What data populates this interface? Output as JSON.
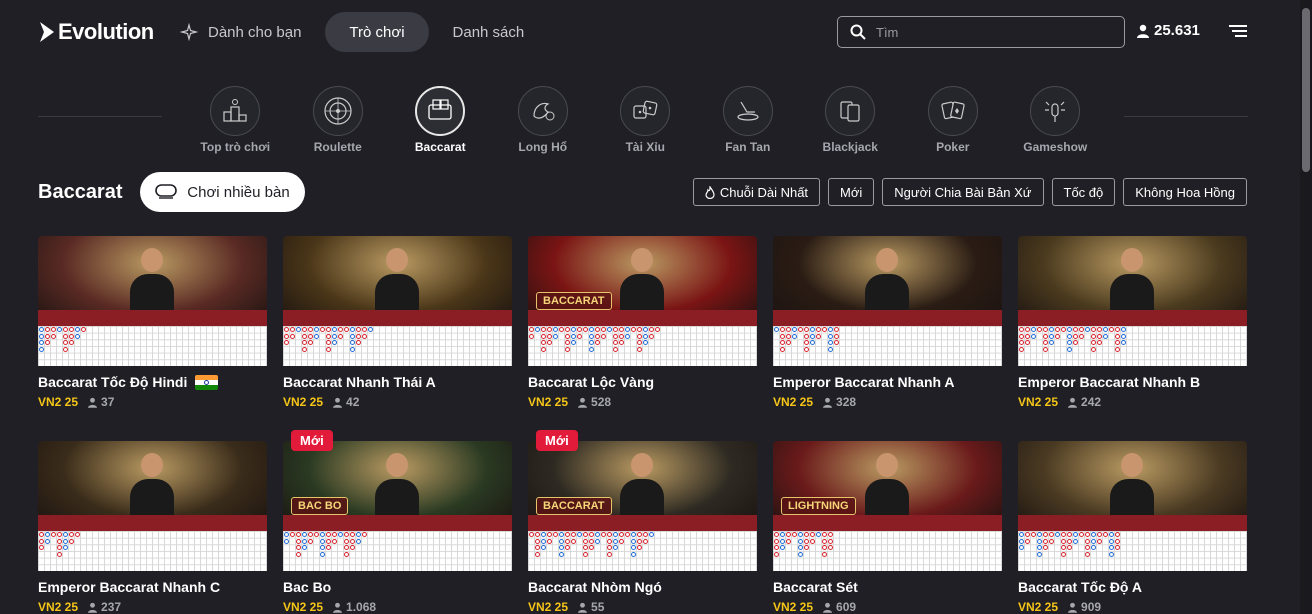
{
  "header": {
    "logo": "Evolution",
    "nav": [
      {
        "label": "Dành cho bạn",
        "icon": "sparkle-icon"
      },
      {
        "label": "Trò chơi"
      },
      {
        "label": "Danh sách"
      }
    ],
    "search_placeholder": "Tìm",
    "balance": "25.631"
  },
  "categories": [
    {
      "label": "Top trò chơi",
      "icon": "podium-icon"
    },
    {
      "label": "Roulette",
      "icon": "roulette-icon"
    },
    {
      "label": "Baccarat",
      "icon": "baccarat-icon",
      "active": true
    },
    {
      "label": "Long Hổ",
      "icon": "dragon-tiger-icon"
    },
    {
      "label": "Tài Xỉu",
      "icon": "dice-icon"
    },
    {
      "label": "Fan Tan",
      "icon": "fan-tan-icon"
    },
    {
      "label": "Blackjack",
      "icon": "blackjack-icon"
    },
    {
      "label": "Poker",
      "icon": "poker-icon"
    },
    {
      "label": "Gameshow",
      "icon": "gameshow-icon"
    }
  ],
  "section": {
    "title": "Baccarat",
    "multi_label": "Chơi nhiều bàn",
    "filters": [
      "Chuỗi Dài Nhất",
      "Mới",
      "Người Chia Bài Bản Xứ",
      "Tốc độ",
      "Không Hoa Hồng"
    ]
  },
  "cards": [
    {
      "name": "Baccarat Tốc Độ Hindi",
      "bet": "VN2 25",
      "players": "37",
      "flag": true,
      "theme": "#5a2a24"
    },
    {
      "name": "Baccarat Nhanh Thái A",
      "bet": "VN2 25",
      "players": "42",
      "theme": "#4a3618"
    },
    {
      "name": "Baccarat Lộc Vàng",
      "bet": "VN2 25",
      "players": "528",
      "theme": "#7a1414",
      "overlay": "BACCARAT"
    },
    {
      "name": "Emperor Baccarat Nhanh A",
      "bet": "VN2 25",
      "players": "328",
      "theme": "#2a1c14"
    },
    {
      "name": "Emperor Baccarat Nhanh B",
      "bet": "VN2 25",
      "players": "242",
      "theme": "#4a3a1e"
    },
    {
      "name": "Emperor Baccarat Nhanh C",
      "bet": "VN2 25",
      "players": "237",
      "theme": "#3a2c1a"
    },
    {
      "name": "Bac Bo",
      "bet": "VN2 25",
      "players": "1.068",
      "badge": "Mới",
      "theme": "#2a3a22",
      "overlay": "BAC BO"
    },
    {
      "name": "Baccarat Nhòm Ngó",
      "bet": "VN2 25",
      "players": "55",
      "badge": "Mới",
      "theme": "#2e2a22",
      "overlay": "BACCARAT"
    },
    {
      "name": "Baccarat Sét",
      "bet": "VN2 25",
      "players": "609",
      "theme": "#6a1a1a",
      "overlay": "LIGHTNING"
    },
    {
      "name": "Baccarat Tốc Độ A",
      "bet": "VN2 25",
      "players": "909",
      "theme": "#4a3a22"
    }
  ]
}
